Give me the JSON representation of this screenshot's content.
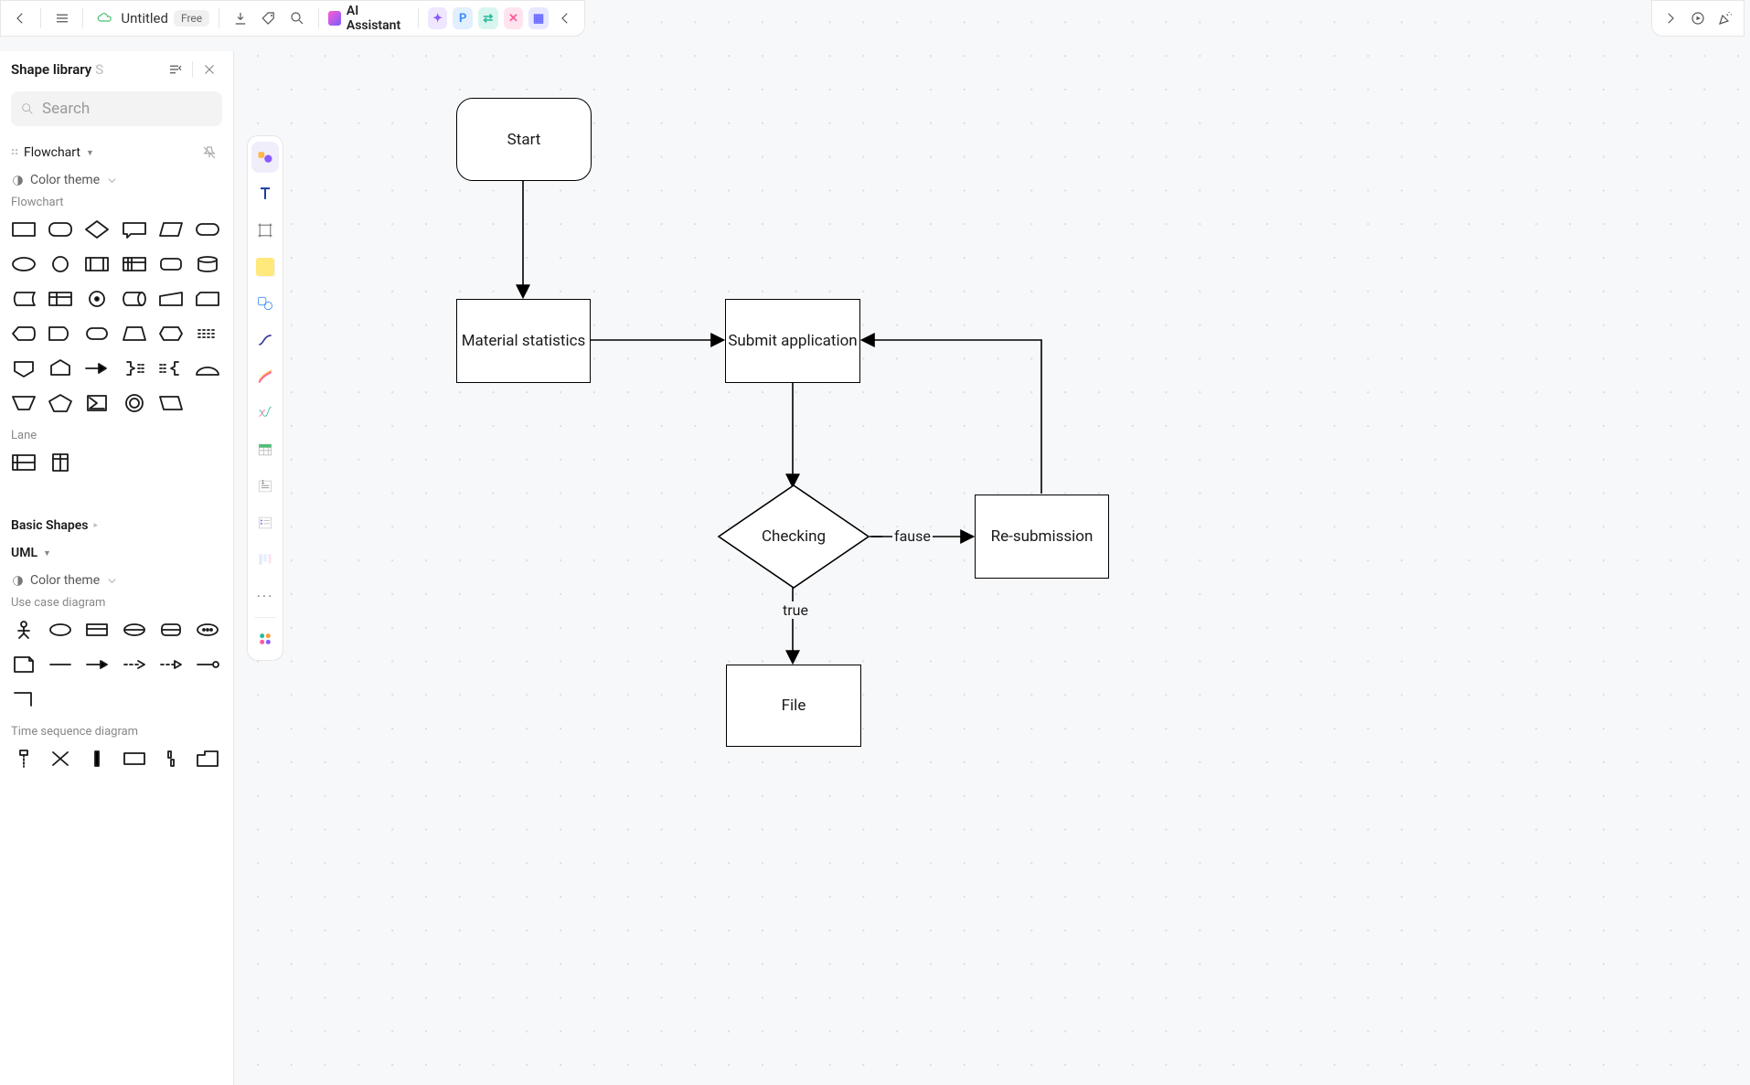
{
  "header": {
    "doc_title": "Untitled",
    "plan_badge": "Free",
    "ai_label": "AI Assistant",
    "chips": [
      "✦",
      "P",
      "⇄",
      "✕",
      "▦"
    ]
  },
  "panel": {
    "title": "Shape library",
    "shortcut": "S",
    "search_placeholder": "Search",
    "sections": {
      "flowchart": "Flowchart",
      "color_theme": "Color theme",
      "flowchart_sub": "Flowchart",
      "lane": "Lane",
      "basic": "Basic Shapes",
      "uml": "UML",
      "use_case": "Use case diagram",
      "time_seq": "Time sequence diagram"
    }
  },
  "flow": {
    "start": "Start",
    "material": "Material statistics",
    "submit": "Submit application",
    "checking": "Checking",
    "resubmit": "Re-submission",
    "file": "File",
    "label_false": "fause",
    "label_true": "true"
  }
}
